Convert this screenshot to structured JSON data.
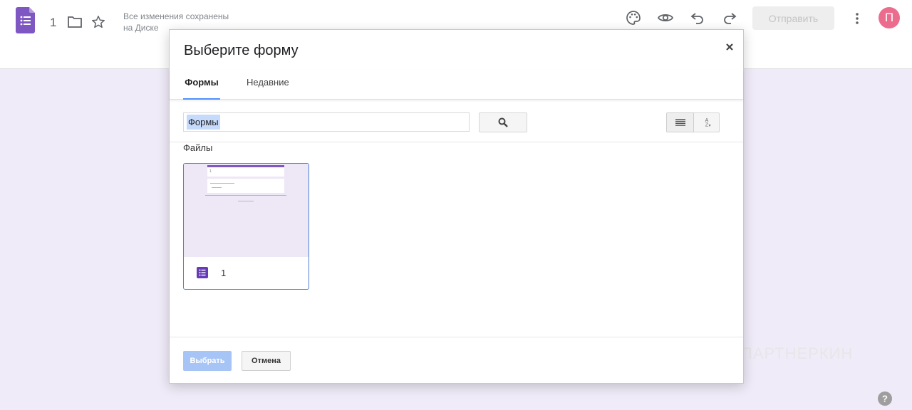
{
  "header": {
    "doc_title": "1",
    "save_status_line1": "Все изменения сохранены",
    "save_status_line2": "на Диске",
    "send_label": "Отправить",
    "avatar_letter": "П"
  },
  "dialog": {
    "title": "Выберите форму",
    "tabs": [
      {
        "label": "Формы",
        "active": true
      },
      {
        "label": "Недавние",
        "active": false
      }
    ],
    "search_value": "Формы",
    "section_label": "Файлы",
    "files": [
      {
        "name": "1",
        "thumb_title": "1"
      }
    ],
    "select_label": "Выбрать",
    "cancel_label": "Отмена"
  },
  "watermark": {
    "text": "ПАРТНЕРКИН"
  },
  "colors": {
    "forms_purple": "#673ab7",
    "accent_blue": "#4d90fe",
    "background": "#f0ebf8",
    "avatar": "#ec6c8e"
  },
  "icons": [
    "google-forms-icon",
    "folder-icon",
    "star-icon",
    "palette-icon",
    "eye-icon",
    "undo-icon",
    "redo-icon",
    "more-vert-icon",
    "close-icon",
    "search-icon",
    "list-view-icon",
    "sort-az-icon",
    "help-icon"
  ]
}
